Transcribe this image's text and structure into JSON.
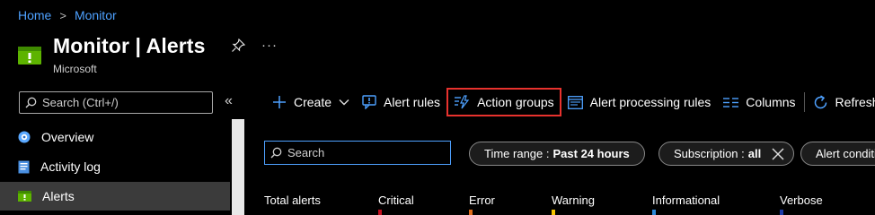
{
  "breadcrumb": {
    "home": "Home",
    "sep": ">",
    "current": "Monitor"
  },
  "header": {
    "title": "Monitor | Alerts",
    "subtitle": "Microsoft",
    "more": "···"
  },
  "sidebar": {
    "search_placeholder": "Search (Ctrl+/)",
    "collapse": "«",
    "items": [
      {
        "label": "Overview",
        "icon": "overview-icon"
      },
      {
        "label": "Activity log",
        "icon": "activity-log-icon"
      },
      {
        "label": "Alerts",
        "icon": "alerts-icon",
        "active": true
      }
    ]
  },
  "toolbar": {
    "create": "Create",
    "alert_rules": "Alert rules",
    "action_groups": "Action groups",
    "alert_processing_rules": "Alert processing rules",
    "columns": "Columns",
    "refresh": "Refresh"
  },
  "filters": {
    "search_placeholder": "Search",
    "time_range_label": "Time range : ",
    "time_range_value": "Past 24 hours",
    "subscription_label": "Subscription : ",
    "subscription_value": "all",
    "alert_condition": "Alert conditi"
  },
  "summary": {
    "total": "Total alerts",
    "critical": "Critical",
    "error": "Error",
    "warning": "Warning",
    "informational": "Informational",
    "verbose": "Verbose"
  },
  "colors": {
    "accent": "#4ea1ff",
    "highlight": "#e8322e",
    "critical": "#c50f1f",
    "error": "#e06c1b",
    "warning": "#f7c300",
    "informational": "#2b88d8",
    "verbose": "#1b3aa8"
  }
}
